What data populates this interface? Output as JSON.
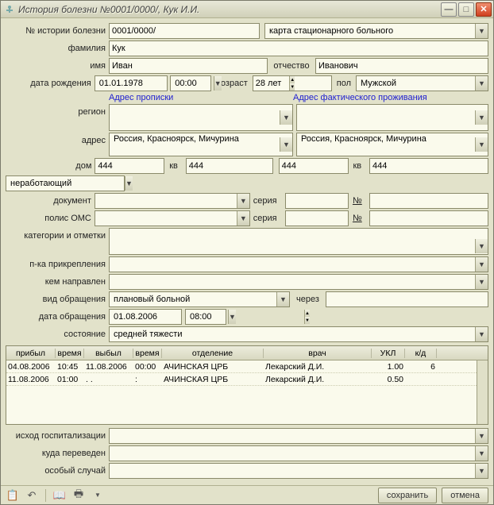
{
  "window": {
    "title": "История болезни №0001/0000/, Кук И.И."
  },
  "labels": {
    "history_no": "№ истории болезни",
    "surname": "фамилия",
    "name": "имя",
    "patronymic": "отчество",
    "dob": "дата рождения",
    "age": "возраст",
    "sex": "пол",
    "addr_reg": "Адрес прописки",
    "addr_fact": "Адрес фактического проживания",
    "region": "регион",
    "address": "адрес",
    "house": "дом",
    "flat": "кв",
    "employment": "неработающий",
    "document": "документ",
    "series": "серия",
    "number": "№",
    "omc": "полис ОМС",
    "categories": "категории и отметки",
    "attach": "п-ка прикрепления",
    "referred": "кем направлен",
    "visit_type": "вид обращения",
    "through": "через",
    "visit_date": "дата обращения",
    "state": "состояние",
    "outcome": "исход госпитализации",
    "transfer": "куда переведен",
    "special": "особый случай",
    "save": "сохранить",
    "cancel": "отмена"
  },
  "card_type": "карта стационарного больного",
  "patient": {
    "history_no": "0001/0000/",
    "surname": "Кук",
    "name": "Иван",
    "patronymic": "Иванович",
    "dob": "01.01.1978",
    "dob_time": "00:00",
    "age": "28 лет",
    "sex": "Мужской"
  },
  "reg": {
    "region": "",
    "address": "Россия, Красноярск, Мичурина",
    "house": "444",
    "flat": "444"
  },
  "fact": {
    "region": "",
    "address": "Россия, Красноярск, Мичурина",
    "house": "444",
    "flat": "444"
  },
  "doc": {
    "type": "",
    "series": "",
    "number": ""
  },
  "omc": {
    "value": "",
    "series": "",
    "number": ""
  },
  "categories": "",
  "attach": "",
  "referred": "",
  "visit": {
    "type": "плановый больной",
    "through": "",
    "date": "01.08.2006",
    "time": "08:00"
  },
  "state": "средней тяжести",
  "outcome": "",
  "transfer": "",
  "special": "",
  "table": {
    "hdr": {
      "arr": "прибыл",
      "t1": "время",
      "dep": "выбыл",
      "t2": "время",
      "ward": "отделение",
      "doc": "врач",
      "ukl": "УКЛ",
      "kd": "к/д"
    },
    "rows": [
      {
        "arr": "04.08.2006",
        "t1": "10:45",
        "dep": "11.08.2006",
        "t2": "00:00",
        "ward": "АЧИНСКАЯ ЦРБ",
        "doc": "Лекарский Д.И.",
        "ukl": "1.00",
        "kd": "6"
      },
      {
        "arr": "11.08.2006",
        "t1": "01:00",
        "dep": ".  .",
        "t2": ":",
        "ward": "АЧИНСКАЯ ЦРБ",
        "doc": "Лекарский Д.И.",
        "ukl": "0.50",
        "kd": ""
      }
    ]
  }
}
